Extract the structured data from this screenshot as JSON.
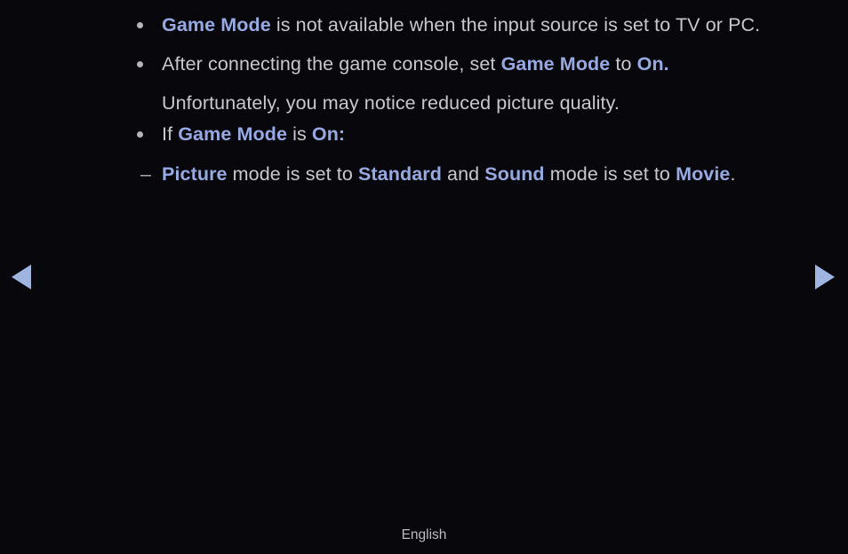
{
  "screen": {
    "background_color": "#07070c",
    "body_text_color": "#c8c8cc",
    "highlight_color": "#97a9e2",
    "arrow_color": "#a0b4e0"
  },
  "content": {
    "items": [
      {
        "marker": "bullet",
        "segments": [
          {
            "text": "Game Mode",
            "highlight": true
          },
          {
            "text": " is not available when the input source is set to TV or PC.",
            "highlight": false
          }
        ]
      },
      {
        "marker": "bullet",
        "segments": [
          {
            "text": "After connecting the game console, set ",
            "highlight": false
          },
          {
            "text": "Game Mode",
            "highlight": true
          },
          {
            "text": " to ",
            "highlight": false
          },
          {
            "text": "On.",
            "highlight": true
          }
        ],
        "wrapped_line": "Unfortunately, you may notice reduced picture quality."
      },
      {
        "marker": "bullet",
        "segments": [
          {
            "text": "If ",
            "highlight": false
          },
          {
            "text": "Game Mode",
            "highlight": true
          },
          {
            "text": " is ",
            "highlight": false
          },
          {
            "text": "On:",
            "highlight": true
          }
        ]
      },
      {
        "marker": "dash",
        "dash_glyph": "–",
        "segments": [
          {
            "text": "Picture",
            "highlight": true
          },
          {
            "text": " mode is set to ",
            "highlight": false
          },
          {
            "text": "Standard",
            "highlight": true
          },
          {
            "text": " and ",
            "highlight": false
          },
          {
            "text": "Sound",
            "highlight": true
          },
          {
            "text": " mode is set to ",
            "highlight": false
          },
          {
            "text": "Movie",
            "highlight": true
          },
          {
            "text": ".",
            "highlight": false
          }
        ]
      }
    ]
  },
  "navigation": {
    "previous_label": "◀",
    "next_label": "▶"
  },
  "footer": {
    "language": "English"
  }
}
